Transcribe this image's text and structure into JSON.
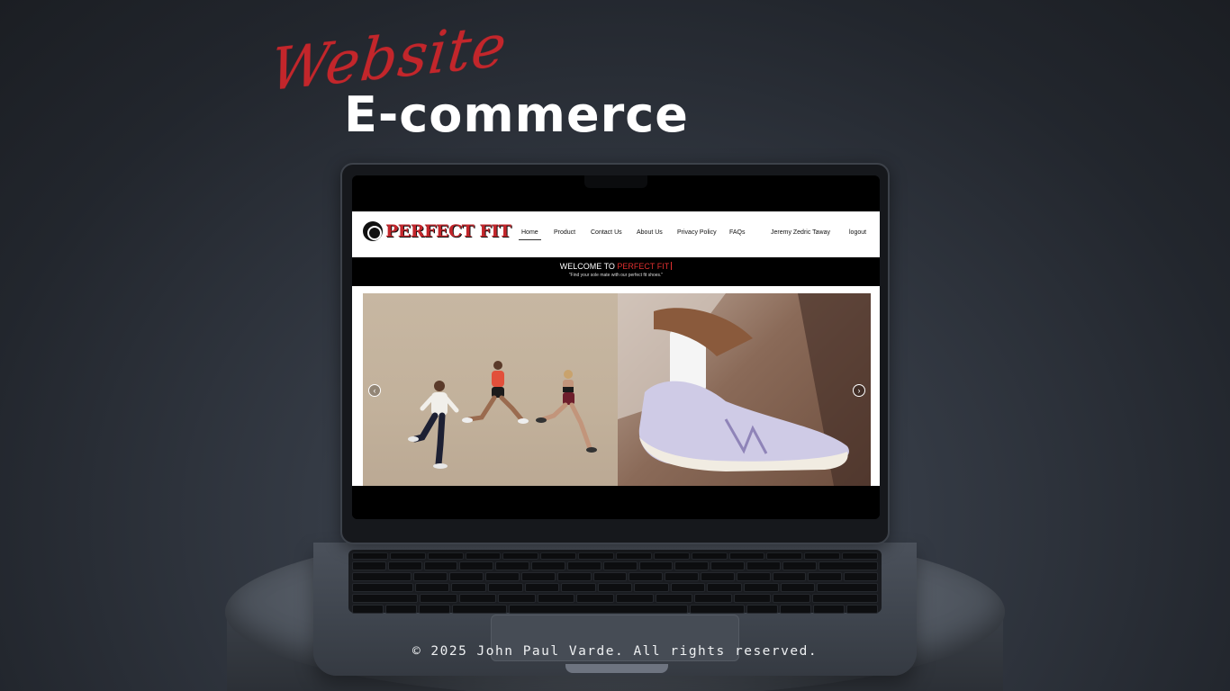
{
  "headings": {
    "script": "Website",
    "main": "E-commerce"
  },
  "site": {
    "logo_text": "PERFECT FIT",
    "nav": [
      {
        "label": "Home",
        "active": true
      },
      {
        "label": "Product"
      },
      {
        "label": "Contact Us"
      },
      {
        "label": "About Us"
      },
      {
        "label": "Privacy Policy"
      },
      {
        "label": "FAQs"
      }
    ],
    "user_name": "Jeremy Zedric  Taway",
    "logout_label": "logout",
    "welcome_prefix": "WELCOME TO ",
    "welcome_brand": "PERFECT FIT",
    "tagline": "\"Find your sole mate with our perfect fit shoes.\"",
    "carousel": {
      "prev_glyph": "‹",
      "next_glyph": "›"
    }
  },
  "footer": {
    "credit": "© 2025 John Paul Varde. All rights reserved."
  },
  "colors": {
    "accent_red": "#c3262b",
    "screen_black": "#000000",
    "background": "#2b3038"
  }
}
